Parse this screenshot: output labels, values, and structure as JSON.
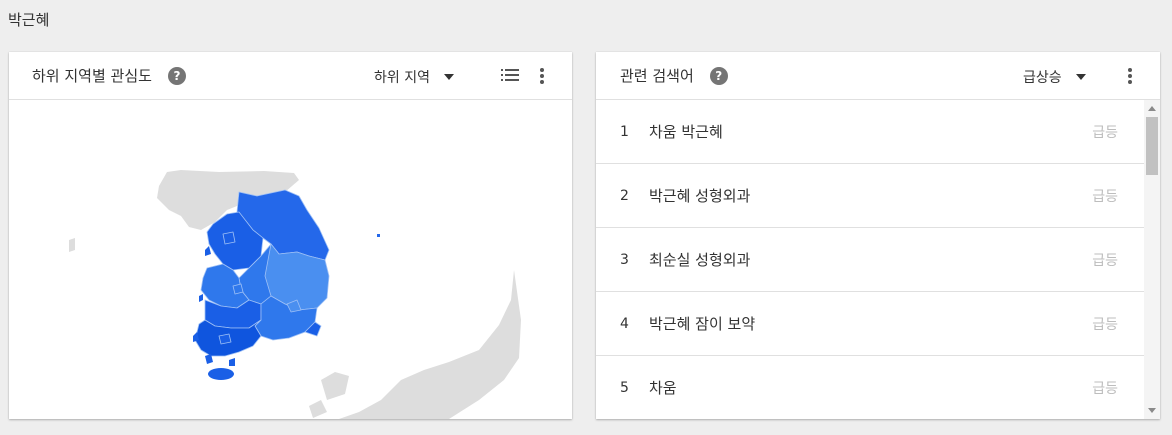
{
  "page": {
    "title": "박근혜"
  },
  "region_card": {
    "title": "하위 지역별 관심도",
    "help_glyph": "?",
    "dropdown_label": "하위 지역",
    "colors": {
      "strong": "#1a5fe6",
      "medium": "#2f78ec",
      "light": "#4a8ff0",
      "land": "#dddddd"
    }
  },
  "related_card": {
    "title": "관련 검색어",
    "help_glyph": "?",
    "dropdown_label": "급상승",
    "items": [
      {
        "rank": "1",
        "query": "차움 박근혜",
        "badge": "급등"
      },
      {
        "rank": "2",
        "query": "박근혜 성형외과",
        "badge": "급등"
      },
      {
        "rank": "3",
        "query": "최순실 성형외과",
        "badge": "급등"
      },
      {
        "rank": "4",
        "query": "박근혜 잠이 보약",
        "badge": "급등"
      },
      {
        "rank": "5",
        "query": "차움",
        "badge": "급등"
      }
    ]
  }
}
